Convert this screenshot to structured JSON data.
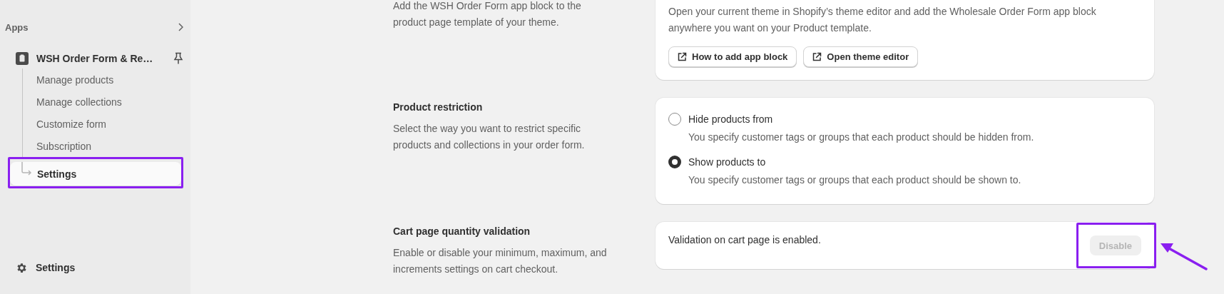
{
  "sidebar": {
    "section_label": "Apps",
    "app": {
      "name": "WSH Order Form & Re…"
    },
    "items": [
      {
        "label": "Manage products",
        "selected": false,
        "highlighted": false
      },
      {
        "label": "Manage collections",
        "selected": false,
        "highlighted": false
      },
      {
        "label": "Customize form",
        "selected": false,
        "highlighted": false
      },
      {
        "label": "Subscription",
        "selected": false,
        "highlighted": false
      },
      {
        "label": "Settings",
        "selected": true,
        "highlighted": true
      }
    ],
    "footer_item": {
      "label": "Settings"
    }
  },
  "sections": [
    {
      "kind": "app_block",
      "description": "Add the WSH Order Form app block to the product page template of your theme.",
      "card_text": "Open your current theme in Shopify’s theme editor and add the Wholesale Order Form app block anywhere you want on your Product template.",
      "buttons": [
        "How to add app block",
        "Open theme editor"
      ]
    },
    {
      "kind": "radio",
      "title": "Product restriction",
      "description": "Select the way you want to restrict specific products and collections in your order form.",
      "options": [
        {
          "label": "Hide products from",
          "help": "You specify customer tags or groups that each product should be hidden from.",
          "selected": false
        },
        {
          "label": "Show products to",
          "help": "You specify customer tags or groups that each product should be shown to.",
          "selected": true
        }
      ]
    },
    {
      "kind": "status",
      "title": "Cart page quantity validation",
      "description": "Enable or disable your minimum, maximum, and increments settings on cart checkout.",
      "status": "Validation on cart page is enabled.",
      "button": {
        "label": "Disable",
        "disabled": true,
        "highlighted": true
      },
      "callout_arrow": true
    }
  ]
}
